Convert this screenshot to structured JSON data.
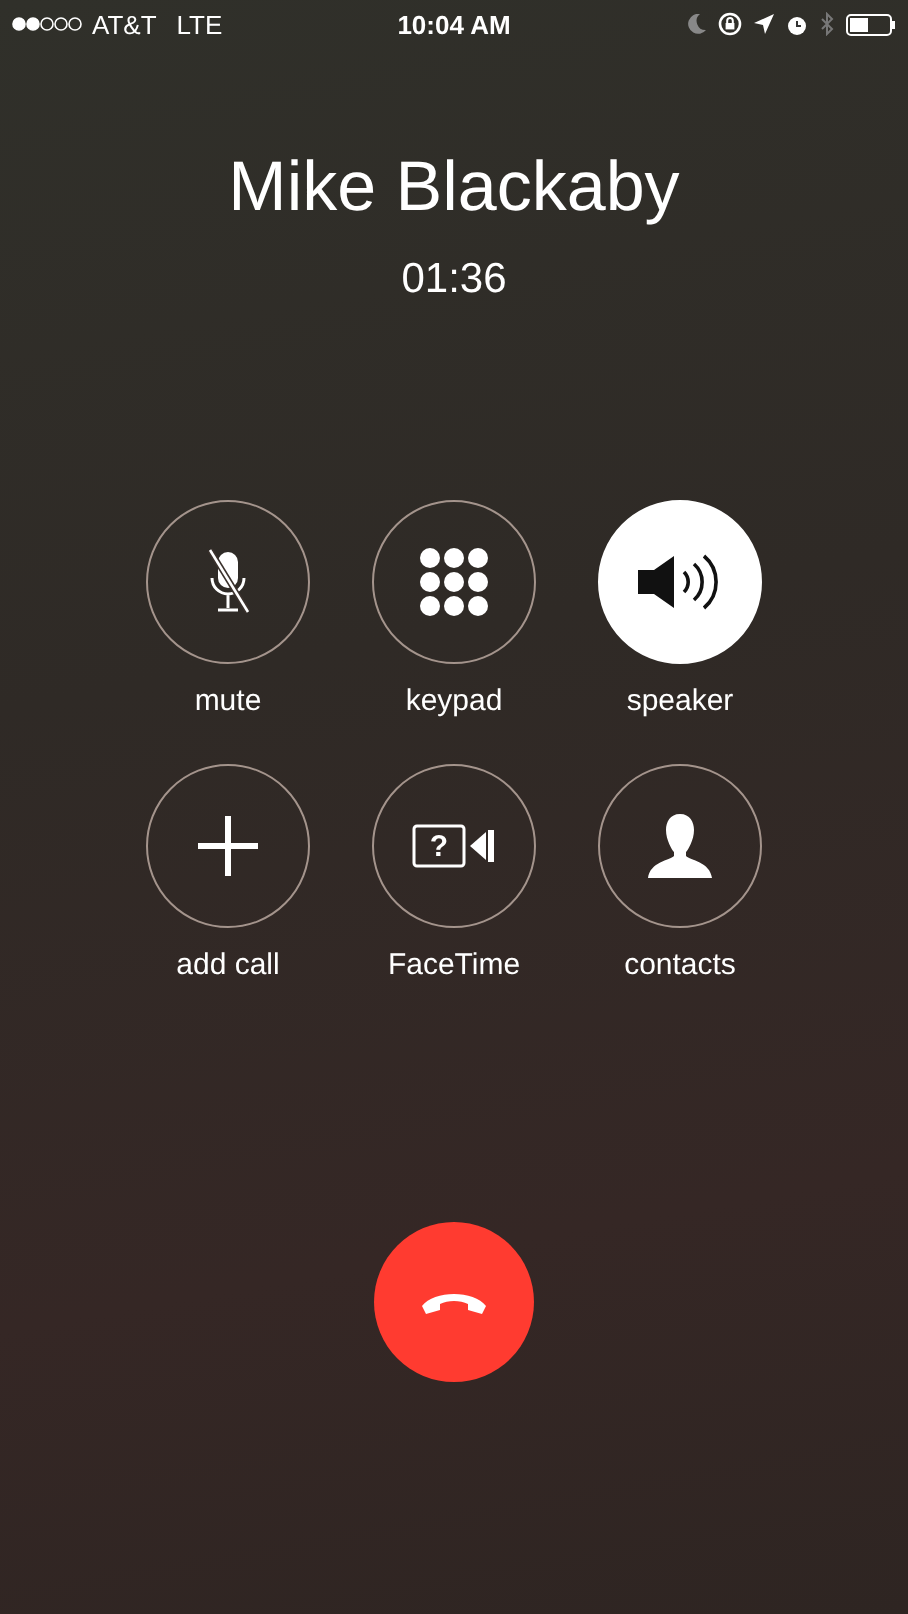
{
  "status_bar": {
    "carrier": "AT&T",
    "network": "LTE",
    "time": "10:04 AM"
  },
  "caller": {
    "name": "Mike Blackaby",
    "duration": "01:36"
  },
  "buttons": [
    {
      "label": "mute",
      "kind": "mic-off",
      "selected": false
    },
    {
      "label": "keypad",
      "kind": "keypad",
      "selected": false
    },
    {
      "label": "speaker",
      "kind": "speaker",
      "selected": true
    },
    {
      "label": "add call",
      "kind": "plus",
      "selected": false
    },
    {
      "label": "FaceTime",
      "kind": "facetime",
      "glyph": "?",
      "selected": false
    },
    {
      "label": "contacts",
      "kind": "person",
      "selected": false
    }
  ]
}
